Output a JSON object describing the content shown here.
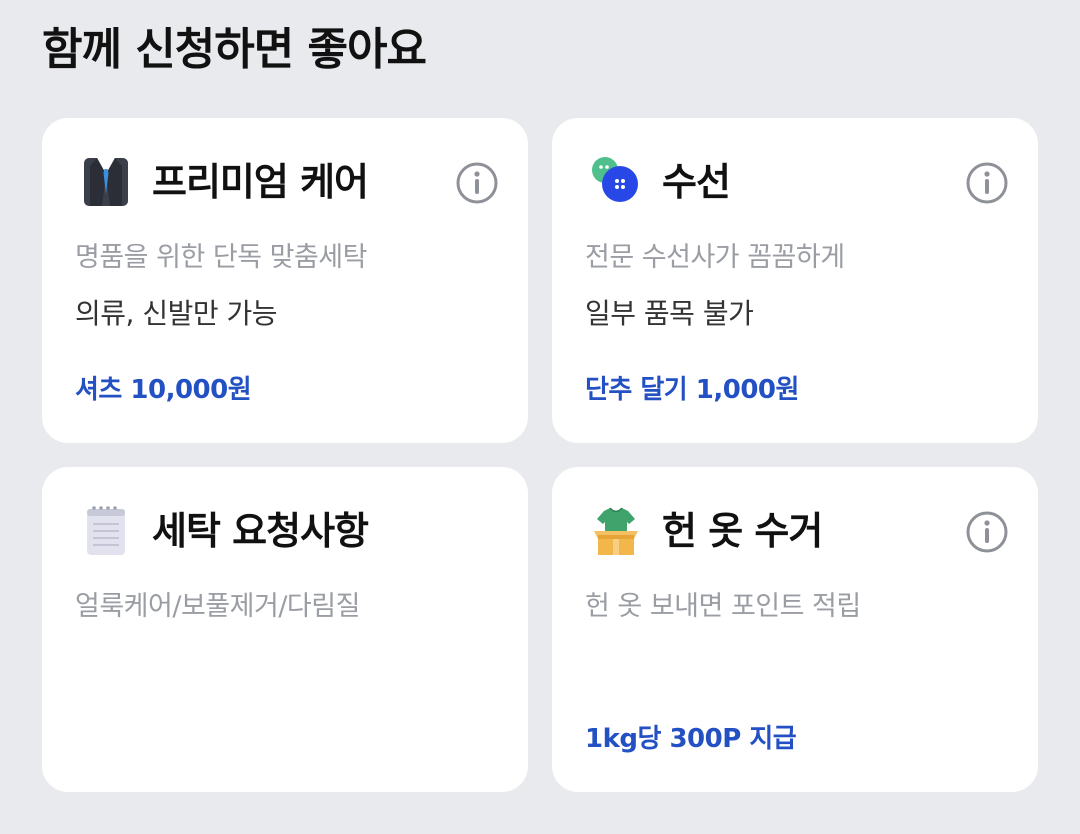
{
  "section": {
    "title": "함께 신청하면 좋아요"
  },
  "colors": {
    "background": "#e9eaed",
    "card": "#ffffff",
    "accent_blue": "#2351c4",
    "muted_text": "#9a9da3"
  },
  "cards": [
    {
      "icon": "suit-icon",
      "title": "프리미엄 케어",
      "description": "명품을 위한 단독 맞춤세탁",
      "note": "의류, 신발만 가능",
      "price": "셔츠 10,000원",
      "has_info": true
    },
    {
      "icon": "buttons-icon",
      "title": "수선",
      "description": "전문 수선사가 꼼꼼하게",
      "note": "일부 품목 불가",
      "price": "단추 달기 1,000원",
      "has_info": true
    },
    {
      "icon": "notepad-icon",
      "title": "세탁 요청사항",
      "description": "얼룩케어/보풀제거/다림질",
      "has_info": false
    },
    {
      "icon": "clothes-box-icon",
      "title": "헌 옷 수거",
      "description": "헌 옷 보내면 포인트 적립",
      "price": "1kg당 300P 지급",
      "has_info": true
    }
  ]
}
